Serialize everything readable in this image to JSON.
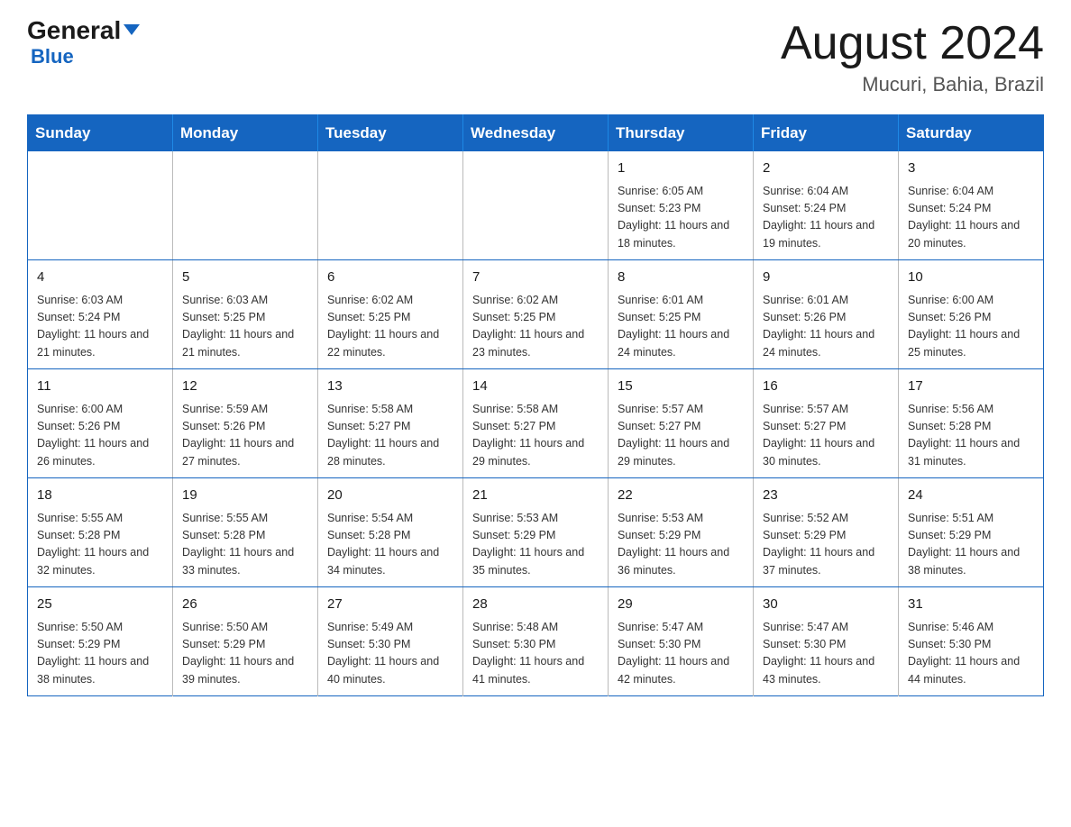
{
  "header": {
    "logo_general": "General",
    "logo_triangle": "▶",
    "logo_blue": "Blue",
    "month_title": "August 2024",
    "location": "Mucuri, Bahia, Brazil"
  },
  "days_of_week": [
    "Sunday",
    "Monday",
    "Tuesday",
    "Wednesday",
    "Thursday",
    "Friday",
    "Saturday"
  ],
  "weeks": [
    [
      {
        "day": "",
        "info": ""
      },
      {
        "day": "",
        "info": ""
      },
      {
        "day": "",
        "info": ""
      },
      {
        "day": "",
        "info": ""
      },
      {
        "day": "1",
        "info": "Sunrise: 6:05 AM\nSunset: 5:23 PM\nDaylight: 11 hours and 18 minutes."
      },
      {
        "day": "2",
        "info": "Sunrise: 6:04 AM\nSunset: 5:24 PM\nDaylight: 11 hours and 19 minutes."
      },
      {
        "day": "3",
        "info": "Sunrise: 6:04 AM\nSunset: 5:24 PM\nDaylight: 11 hours and 20 minutes."
      }
    ],
    [
      {
        "day": "4",
        "info": "Sunrise: 6:03 AM\nSunset: 5:24 PM\nDaylight: 11 hours and 21 minutes."
      },
      {
        "day": "5",
        "info": "Sunrise: 6:03 AM\nSunset: 5:25 PM\nDaylight: 11 hours and 21 minutes."
      },
      {
        "day": "6",
        "info": "Sunrise: 6:02 AM\nSunset: 5:25 PM\nDaylight: 11 hours and 22 minutes."
      },
      {
        "day": "7",
        "info": "Sunrise: 6:02 AM\nSunset: 5:25 PM\nDaylight: 11 hours and 23 minutes."
      },
      {
        "day": "8",
        "info": "Sunrise: 6:01 AM\nSunset: 5:25 PM\nDaylight: 11 hours and 24 minutes."
      },
      {
        "day": "9",
        "info": "Sunrise: 6:01 AM\nSunset: 5:26 PM\nDaylight: 11 hours and 24 minutes."
      },
      {
        "day": "10",
        "info": "Sunrise: 6:00 AM\nSunset: 5:26 PM\nDaylight: 11 hours and 25 minutes."
      }
    ],
    [
      {
        "day": "11",
        "info": "Sunrise: 6:00 AM\nSunset: 5:26 PM\nDaylight: 11 hours and 26 minutes."
      },
      {
        "day": "12",
        "info": "Sunrise: 5:59 AM\nSunset: 5:26 PM\nDaylight: 11 hours and 27 minutes."
      },
      {
        "day": "13",
        "info": "Sunrise: 5:58 AM\nSunset: 5:27 PM\nDaylight: 11 hours and 28 minutes."
      },
      {
        "day": "14",
        "info": "Sunrise: 5:58 AM\nSunset: 5:27 PM\nDaylight: 11 hours and 29 minutes."
      },
      {
        "day": "15",
        "info": "Sunrise: 5:57 AM\nSunset: 5:27 PM\nDaylight: 11 hours and 29 minutes."
      },
      {
        "day": "16",
        "info": "Sunrise: 5:57 AM\nSunset: 5:27 PM\nDaylight: 11 hours and 30 minutes."
      },
      {
        "day": "17",
        "info": "Sunrise: 5:56 AM\nSunset: 5:28 PM\nDaylight: 11 hours and 31 minutes."
      }
    ],
    [
      {
        "day": "18",
        "info": "Sunrise: 5:55 AM\nSunset: 5:28 PM\nDaylight: 11 hours and 32 minutes."
      },
      {
        "day": "19",
        "info": "Sunrise: 5:55 AM\nSunset: 5:28 PM\nDaylight: 11 hours and 33 minutes."
      },
      {
        "day": "20",
        "info": "Sunrise: 5:54 AM\nSunset: 5:28 PM\nDaylight: 11 hours and 34 minutes."
      },
      {
        "day": "21",
        "info": "Sunrise: 5:53 AM\nSunset: 5:29 PM\nDaylight: 11 hours and 35 minutes."
      },
      {
        "day": "22",
        "info": "Sunrise: 5:53 AM\nSunset: 5:29 PM\nDaylight: 11 hours and 36 minutes."
      },
      {
        "day": "23",
        "info": "Sunrise: 5:52 AM\nSunset: 5:29 PM\nDaylight: 11 hours and 37 minutes."
      },
      {
        "day": "24",
        "info": "Sunrise: 5:51 AM\nSunset: 5:29 PM\nDaylight: 11 hours and 38 minutes."
      }
    ],
    [
      {
        "day": "25",
        "info": "Sunrise: 5:50 AM\nSunset: 5:29 PM\nDaylight: 11 hours and 38 minutes."
      },
      {
        "day": "26",
        "info": "Sunrise: 5:50 AM\nSunset: 5:29 PM\nDaylight: 11 hours and 39 minutes."
      },
      {
        "day": "27",
        "info": "Sunrise: 5:49 AM\nSunset: 5:30 PM\nDaylight: 11 hours and 40 minutes."
      },
      {
        "day": "28",
        "info": "Sunrise: 5:48 AM\nSunset: 5:30 PM\nDaylight: 11 hours and 41 minutes."
      },
      {
        "day": "29",
        "info": "Sunrise: 5:47 AM\nSunset: 5:30 PM\nDaylight: 11 hours and 42 minutes."
      },
      {
        "day": "30",
        "info": "Sunrise: 5:47 AM\nSunset: 5:30 PM\nDaylight: 11 hours and 43 minutes."
      },
      {
        "day": "31",
        "info": "Sunrise: 5:46 AM\nSunset: 5:30 PM\nDaylight: 11 hours and 44 minutes."
      }
    ]
  ]
}
